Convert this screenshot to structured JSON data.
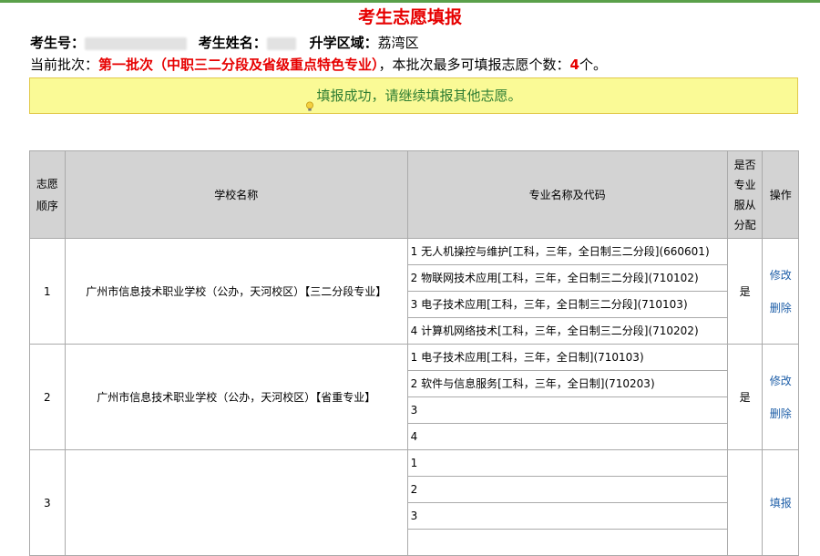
{
  "title": "考生志愿填报",
  "info": {
    "exam_no_label": "考生号：",
    "name_label": "考生姓名：",
    "area_label": "升学区域：",
    "area_value": "荔湾区"
  },
  "batch": {
    "prefix": "当前批次：",
    "name": "第一批次（中职三二分段及省级重点特色专业）",
    "middle": "，本批次最多可填报志愿个数：",
    "count": "4",
    "suffix": "个。"
  },
  "notice": "填报成功，请继续填报其他志愿。",
  "table": {
    "headers": {
      "seq": "志愿顺序",
      "school": "学校名称",
      "major": "专业名称及代码",
      "obey": "是否专业服从分配",
      "op": "操作"
    },
    "rows": [
      {
        "seq": "1",
        "school": "广州市信息技术职业学校（公办，天河校区）【三二分段专业】",
        "majors": [
          "1 无人机操控与维护[工科，三年，全日制三二分段](660601)",
          "2 物联网技术应用[工科，三年，全日制三二分段](710102)",
          "3 电子技术应用[工科，三年，全日制三二分段](710103)",
          "4 计算机网络技术[工科，三年，全日制三二分段](710202)"
        ],
        "obey": "是",
        "op1": "修改",
        "op2": "删除"
      },
      {
        "seq": "2",
        "school": "广州市信息技术职业学校（公办，天河校区）【省重专业】",
        "majors": [
          "1 电子技术应用[工科，三年，全日制](710103)",
          "2 软件与信息服务[工科，三年，全日制](710203)",
          "3",
          "4"
        ],
        "obey": "是",
        "op1": "修改",
        "op2": "删除"
      },
      {
        "seq": "3",
        "school": "",
        "majors": [
          "1",
          "2",
          "3"
        ],
        "obey": "",
        "op1": "填报"
      }
    ]
  },
  "colors": {
    "title": "#e60000",
    "notice_bg": "#fafa96",
    "notice_text": "#2e7d32",
    "link": "#1f5fa8",
    "header_bg": "#d3d3d3"
  }
}
